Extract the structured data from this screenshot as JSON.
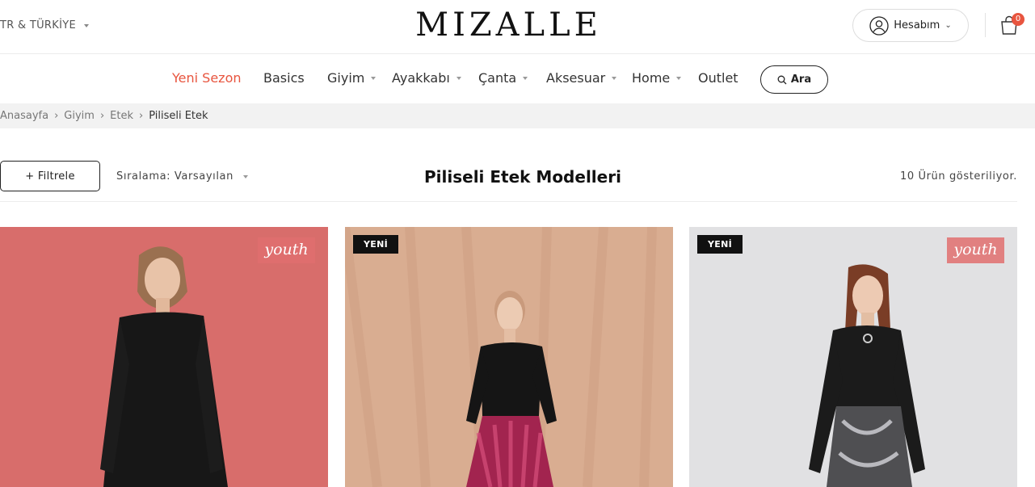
{
  "header": {
    "region": "TR & TÜRKİYE",
    "logo": "MIZALLE",
    "account_label": "Hesabım",
    "cart_count": "0"
  },
  "nav": {
    "items": [
      {
        "label": "Yeni Sezon",
        "active": true,
        "has_dropdown": false
      },
      {
        "label": "Basics",
        "has_dropdown": false
      },
      {
        "label": "Giyim",
        "has_dropdown": true
      },
      {
        "label": "Ayakkabı",
        "has_dropdown": true
      },
      {
        "label": "Çanta",
        "has_dropdown": true
      },
      {
        "label": "Aksesuar",
        "has_dropdown": true
      },
      {
        "label": "Home",
        "has_dropdown": true
      },
      {
        "label": "Outlet",
        "has_dropdown": false
      }
    ],
    "search_label": "Ara"
  },
  "breadcrumb": [
    "Anasayfa",
    "Giyim",
    "Etek",
    "Piliseli Etek"
  ],
  "toolbar": {
    "filter_label": "+ Filtrele",
    "sort_label": "Sıralama: Varsayılan",
    "title": "Piliseli Etek Modelleri",
    "count_text": "10 Ürün gösteriliyor."
  },
  "products": [
    {
      "badge_new": "",
      "badge_youth": "youth",
      "bg": "#d86d6b"
    },
    {
      "badge_new": "YENİ",
      "badge_youth": "",
      "bg": "#d9ad91"
    },
    {
      "badge_new": "YENİ",
      "badge_youth": "youth",
      "bg": "#e1e1e3"
    }
  ],
  "colors": {
    "accent": "#e8553f",
    "text": "#222222",
    "breadcrumb_bg": "#f2f2f2"
  }
}
